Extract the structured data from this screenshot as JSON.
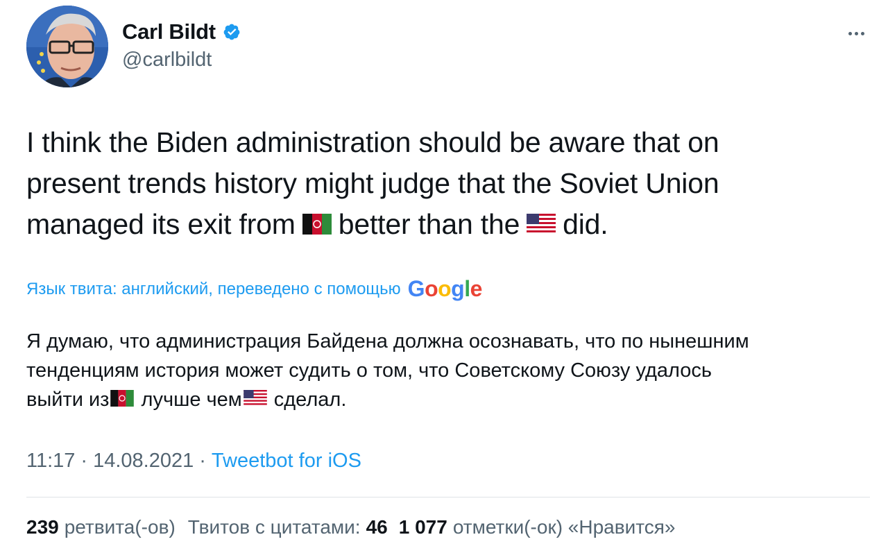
{
  "author": {
    "display_name": "Carl Bildt",
    "handle": "@carlbildt",
    "verified": true
  },
  "tweet": {
    "text_line1": "I think the Biden administration should be aware that on",
    "text_line2": "present trends history might judge that the Soviet Union",
    "text_line3_part1": "managed its exit from",
    "text_line3_part2": "better than the",
    "text_line3_part3": "did.",
    "flag1_icon": "afghanistan-flag-icon",
    "flag2_icon": "usa-flag-icon"
  },
  "translation": {
    "note": "Язык твита: английский, переведено с помощью",
    "provider": "Google",
    "line1": "Я думаю, что администрация Байдена должна осознавать, что по нынешним",
    "line2": "тенденциям история может судить о том, что Советскому Союзу удалось",
    "line3_part1": "выйти из",
    "line3_part2": " лучше чем",
    "line3_part3": " сделал."
  },
  "meta": {
    "time": "11:17",
    "date": "14.08.2021",
    "separator": "·",
    "source": "Tweetbot for iOS"
  },
  "stats": {
    "retweets_count": "239",
    "retweets_label": "ретвита(-ов)",
    "quotes_label": "Твитов с цитатами:",
    "quotes_count": "46",
    "likes_count": "1 077",
    "likes_label": "отметки(-ок) «Нравится»"
  },
  "colors": {
    "link": "#1d9bf0",
    "secondary_text": "#536471",
    "primary_text": "#0f1419",
    "verified_badge": "#1d9bf0"
  }
}
